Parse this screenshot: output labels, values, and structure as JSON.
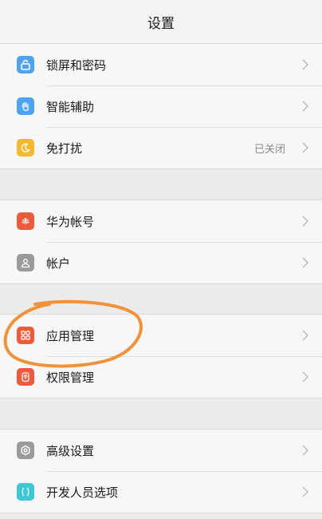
{
  "title": "设置",
  "colors": {
    "lock": "#4ea3f0",
    "assist": "#4ea3f0",
    "moon": "#f5b82e",
    "huawei": "#f05a3c",
    "account": "#9a9a9a",
    "apps": "#f05a3c",
    "permission": "#f05a3c",
    "advanced": "#9a9a9a",
    "developer": "#3ec7d6",
    "annotation": "#f0923a"
  },
  "groups": [
    {
      "items": [
        {
          "label": "锁屏和密码",
          "icon": "lock-screen-icon"
        },
        {
          "label": "智能辅助",
          "icon": "hand-icon"
        },
        {
          "label": "免打扰",
          "icon": "moon-icon",
          "value": "已关闭"
        }
      ]
    },
    {
      "items": [
        {
          "label": "华为帐号",
          "icon": "huawei-logo-icon"
        },
        {
          "label": "帐户",
          "icon": "person-icon"
        }
      ]
    },
    {
      "items": [
        {
          "label": "应用管理",
          "icon": "apps-grid-icon"
        },
        {
          "label": "权限管理",
          "icon": "permission-icon"
        }
      ]
    },
    {
      "items": [
        {
          "label": "高级设置",
          "icon": "gear-icon"
        },
        {
          "label": "开发人员选项",
          "icon": "developer-icon"
        }
      ]
    }
  ]
}
